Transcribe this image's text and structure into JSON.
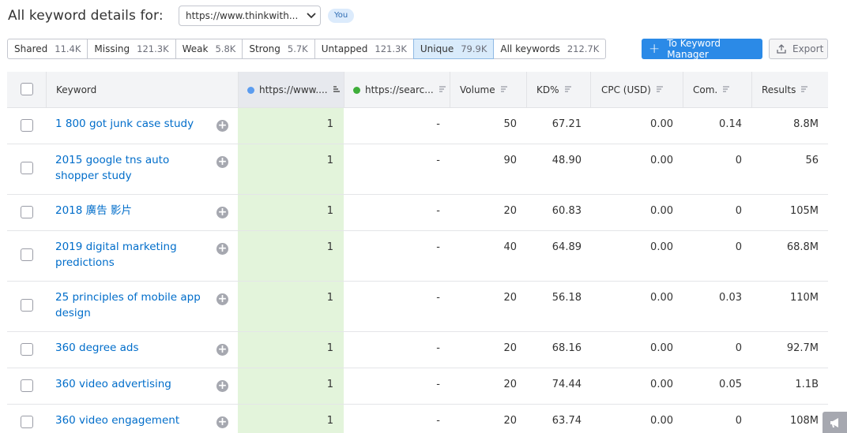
{
  "header": {
    "title": "All keyword details for:",
    "domain_value": "https://www.thinkwith...",
    "you_badge": "You"
  },
  "filters": [
    {
      "label": "Shared",
      "count": "11.4K",
      "active": false
    },
    {
      "label": "Missing",
      "count": "121.3K",
      "active": false
    },
    {
      "label": "Weak",
      "count": "5.8K",
      "active": false
    },
    {
      "label": "Strong",
      "count": "5.7K",
      "active": false
    },
    {
      "label": "Untapped",
      "count": "121.3K",
      "active": false
    },
    {
      "label": "Unique",
      "count": "79.9K",
      "active": true
    },
    {
      "label": "All keywords",
      "count": "212.7K",
      "active": false
    }
  ],
  "actions": {
    "keyword_manager": "To Keyword Manager",
    "export": "Export"
  },
  "columns": {
    "keyword": "Keyword",
    "domain1": "https://www....",
    "domain2": "https://searc...",
    "volume": "Volume",
    "kd": "KD%",
    "cpc": "CPC (USD)",
    "com": "Com.",
    "results": "Results"
  },
  "colors": {
    "domain1_dot": "#5b9cef",
    "domain2_dot": "#3fae3a",
    "highlight": "#e3f4db",
    "link": "#006dca",
    "primary": "#2b8ae7"
  },
  "rows": [
    {
      "keyword": "1 800 got junk case study",
      "d1": "1",
      "d2": "-",
      "volume": "50",
      "kd": "67.21",
      "cpc": "0.00",
      "com": "0.14",
      "results": "8.8M"
    },
    {
      "keyword": "2015 google tns auto shopper study",
      "d1": "1",
      "d2": "-",
      "volume": "90",
      "kd": "48.90",
      "cpc": "0.00",
      "com": "0",
      "results": "56"
    },
    {
      "keyword": "2018 廣告 影片",
      "d1": "1",
      "d2": "-",
      "volume": "20",
      "kd": "60.83",
      "cpc": "0.00",
      "com": "0",
      "results": "105M"
    },
    {
      "keyword": "2019 digital marketing predictions",
      "d1": "1",
      "d2": "-",
      "volume": "40",
      "kd": "64.89",
      "cpc": "0.00",
      "com": "0",
      "results": "68.8M"
    },
    {
      "keyword": "25 principles of mobile app design",
      "d1": "1",
      "d2": "-",
      "volume": "20",
      "kd": "56.18",
      "cpc": "0.00",
      "com": "0.03",
      "results": "110M"
    },
    {
      "keyword": "360 degree ads",
      "d1": "1",
      "d2": "-",
      "volume": "20",
      "kd": "68.16",
      "cpc": "0.00",
      "com": "0",
      "results": "92.7M"
    },
    {
      "keyword": "360 video advertising",
      "d1": "1",
      "d2": "-",
      "volume": "20",
      "kd": "74.44",
      "cpc": "0.00",
      "com": "0.05",
      "results": "1.1B"
    },
    {
      "keyword": "360 video engagement",
      "d1": "1",
      "d2": "-",
      "volume": "20",
      "kd": "63.74",
      "cpc": "0.00",
      "com": "0",
      "results": "108M"
    }
  ]
}
